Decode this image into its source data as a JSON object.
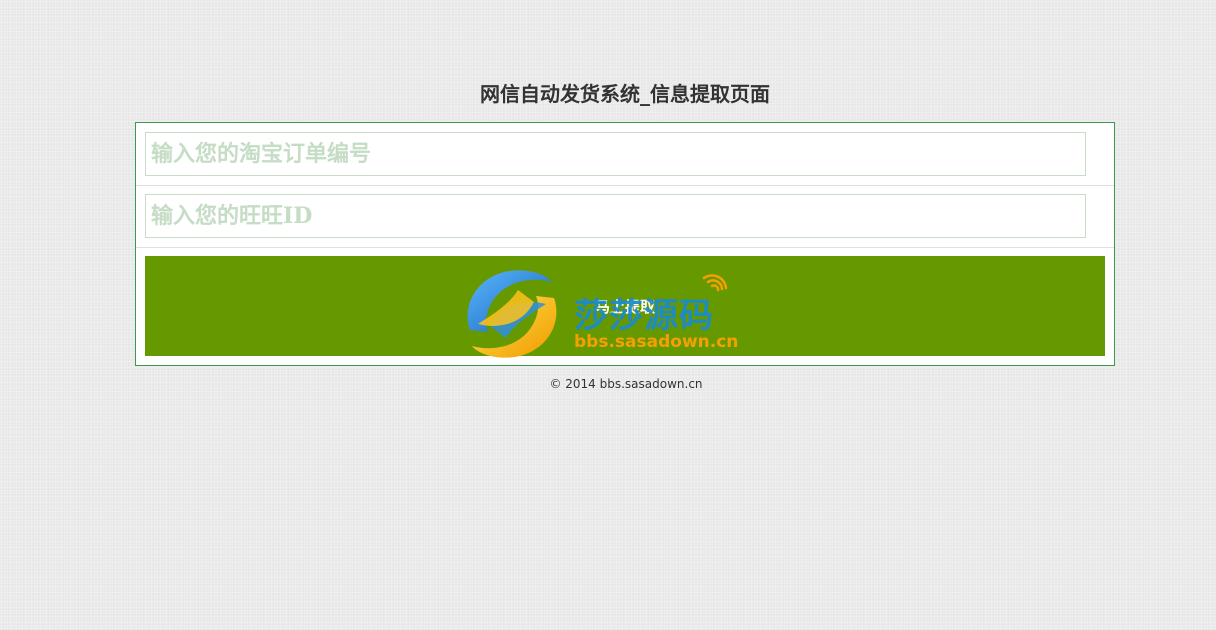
{
  "page": {
    "title": "网信自动发货系统_信息提取页面"
  },
  "form": {
    "order_number": {
      "placeholder": "输入您的淘宝订单编号",
      "value": ""
    },
    "wangwang_id": {
      "placeholder": "输入您的旺旺ID",
      "value": ""
    },
    "submit_label": "马上提取"
  },
  "watermark": {
    "brand": "莎莎源码",
    "url": "bbs.sasadown.cn",
    "icon": "sasa-logo-icon"
  },
  "footer": {
    "copyright": "© 2014 bbs.sasadown.cn"
  },
  "colors": {
    "accent": "#669900",
    "panel_border": "#3a9a4a",
    "placeholder": "#c5dcc5",
    "watermark_blue": "#1a8ad0",
    "watermark_orange": "#f5a000"
  }
}
